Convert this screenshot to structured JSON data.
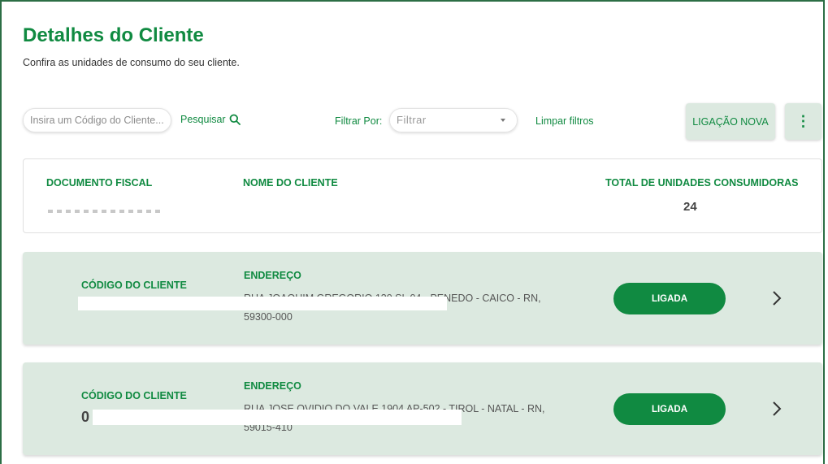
{
  "header": {
    "title": "Detalhes do Cliente",
    "subtitle": "Confira as unidades de consumo do seu cliente."
  },
  "toolbar": {
    "search_placeholder": "Insira um Código do Cliente...",
    "search_label": "Pesquisar",
    "filter_label": "Filtrar Por:",
    "filter_placeholder": "Filtrar",
    "clear_filters_label": "Limpar filtros",
    "new_connection_label": "LIGAÇÃO NOVA",
    "more_menu_label": "⋮"
  },
  "client_info": {
    "document_label": "DOCUMENTO FISCAL",
    "name_label": "NOME DO CLIENTE",
    "total_units_label": "TOTAL DE UNIDADES CONSUMIDORAS",
    "total_units_value": "24"
  },
  "units": [
    {
      "code_label": "CÓDIGO DO CLIENTE",
      "code_value": "",
      "address_label": "ENDEREÇO",
      "address_line1": "RUA JOAQUIM GREGORIO 130 SL 04 - PENEDO - CAICO - RN,",
      "address_line2": "59300-000",
      "status": "LIGADA"
    },
    {
      "code_label": "CÓDIGO DO CLIENTE",
      "code_value": "0",
      "address_label": "ENDEREÇO",
      "address_line1": "RUA JOSE OVIDIO DO VALE 1904 AP-502 - TIROL - NATAL - RN,",
      "address_line2": "59015-410",
      "status": "LIGADA"
    }
  ],
  "colors": {
    "brand_green": "#108a41",
    "card_bg": "#dce9e0"
  },
  "icons": {
    "search": "search-icon",
    "more": "more-vertical-icon",
    "caret": "caret-down-icon",
    "chevron": "chevron-right-icon"
  }
}
